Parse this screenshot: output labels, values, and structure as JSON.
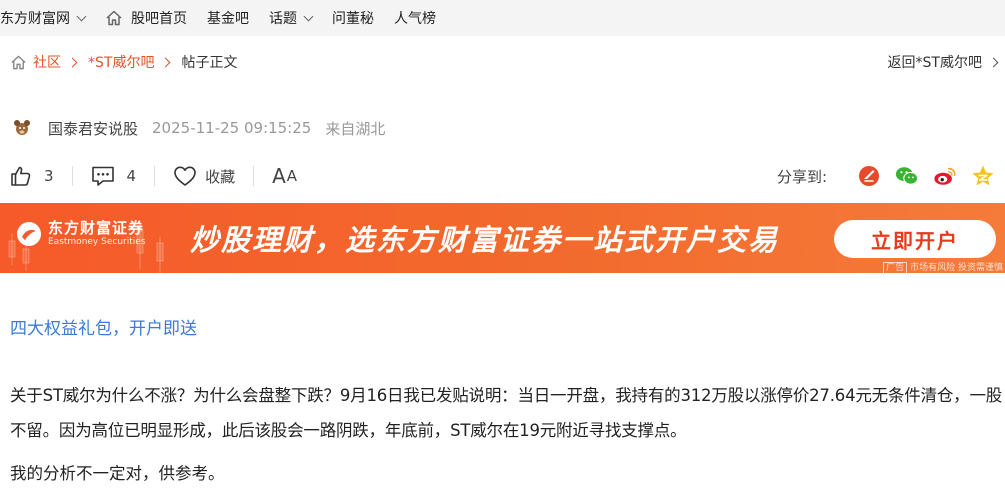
{
  "topnav": {
    "items": [
      {
        "label": "东方财富网",
        "has_dropdown": true,
        "icon": ""
      },
      {
        "label": "股吧首页",
        "has_dropdown": false,
        "icon": "home-icon"
      },
      {
        "label": "基金吧",
        "has_dropdown": false,
        "icon": ""
      },
      {
        "label": "话题",
        "has_dropdown": true,
        "icon": ""
      },
      {
        "label": "问董秘",
        "has_dropdown": false,
        "icon": ""
      },
      {
        "label": "人气榜",
        "has_dropdown": false,
        "icon": ""
      }
    ]
  },
  "breadcrumb": {
    "community": "社区",
    "bar": "*ST威尔吧",
    "current": "帖子正文"
  },
  "back_link": "返回*ST威尔吧",
  "post": {
    "author": "国泰君安说股",
    "time": "2025-11-25 09:15:25",
    "location": "来自湖北"
  },
  "actions": {
    "likes": "3",
    "comments": "4",
    "favorite_label": "收藏",
    "font_big": "A",
    "font_small": "A",
    "share_label": "分享到:"
  },
  "share_icons": [
    "guba-icon",
    "wechat-icon",
    "weibo-icon",
    "qzone-icon"
  ],
  "banner": {
    "brand_name": "东方财富证券",
    "brand_sub": "Eastmoney Securities",
    "slogan": "炒股理财，选东方财富证券一站式开户交易",
    "cta": "立即开户",
    "ad_tag": "广告",
    "risk_note": "市场有风险 投资需谨慎"
  },
  "promo_link": "四大权益礼包，开户即送",
  "content": {
    "p1": "关于ST威尔为什么不涨？为什么会盘整下跌？9月16日我已发贴说明：当日一开盘，我持有的312万股以涨停价27.64元无条件清仓，一股不留。因为高位已明显形成，此后该股会一路阴跌，年底前，ST威尔在19元附近寻找支撑点。",
    "p2": "我的分析不一定对，供参考。"
  },
  "colors": {
    "accent": "#e4532c",
    "link": "#3a7bd5",
    "banner": "#f65a2a",
    "nav_bg": "#f4f4f4"
  }
}
